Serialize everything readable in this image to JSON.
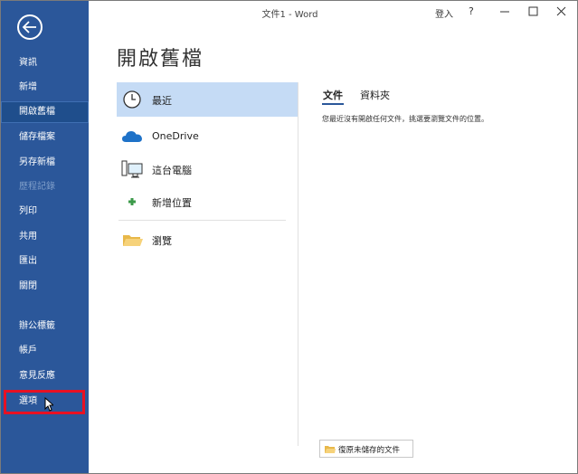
{
  "window": {
    "title": "文件1 - Word",
    "signin_label": "登入",
    "help_label": "?"
  },
  "sidebar": {
    "items": [
      {
        "label": "資訊",
        "state": "normal"
      },
      {
        "label": "新增",
        "state": "normal"
      },
      {
        "label": "開啟舊檔",
        "state": "active"
      },
      {
        "label": "儲存檔案",
        "state": "normal"
      },
      {
        "label": "另存新檔",
        "state": "normal"
      },
      {
        "label": "歷程記錄",
        "state": "disabled"
      },
      {
        "label": "列印",
        "state": "normal"
      },
      {
        "label": "共用",
        "state": "normal"
      },
      {
        "label": "匯出",
        "state": "normal"
      },
      {
        "label": "關閉",
        "state": "normal"
      },
      {
        "label": "辦公標籤",
        "state": "normal"
      },
      {
        "label": "帳戶",
        "state": "normal"
      },
      {
        "label": "意見反應",
        "state": "normal"
      },
      {
        "label": "選項",
        "state": "highlighted"
      }
    ]
  },
  "main": {
    "title": "開啟舊檔",
    "locations": [
      {
        "label": "最近",
        "icon": "clock-icon"
      },
      {
        "label": "OneDrive",
        "icon": "cloud-icon"
      },
      {
        "label": "這台電腦",
        "icon": "computer-icon"
      },
      {
        "label": "新增位置",
        "icon": "plus-icon"
      },
      {
        "label": "瀏覽",
        "icon": "folder-icon"
      }
    ],
    "tabs": [
      {
        "label": "文件"
      },
      {
        "label": "資料夾"
      }
    ],
    "empty_message": "您最近沒有開啟任何文件，挑選要瀏覽文件的位置。",
    "restore_button": "復原未儲存的文件"
  },
  "colors": {
    "sidebar_bg": "#2b579a",
    "selected_bg": "#c5dbf5",
    "highlight_red": "#e81123"
  }
}
